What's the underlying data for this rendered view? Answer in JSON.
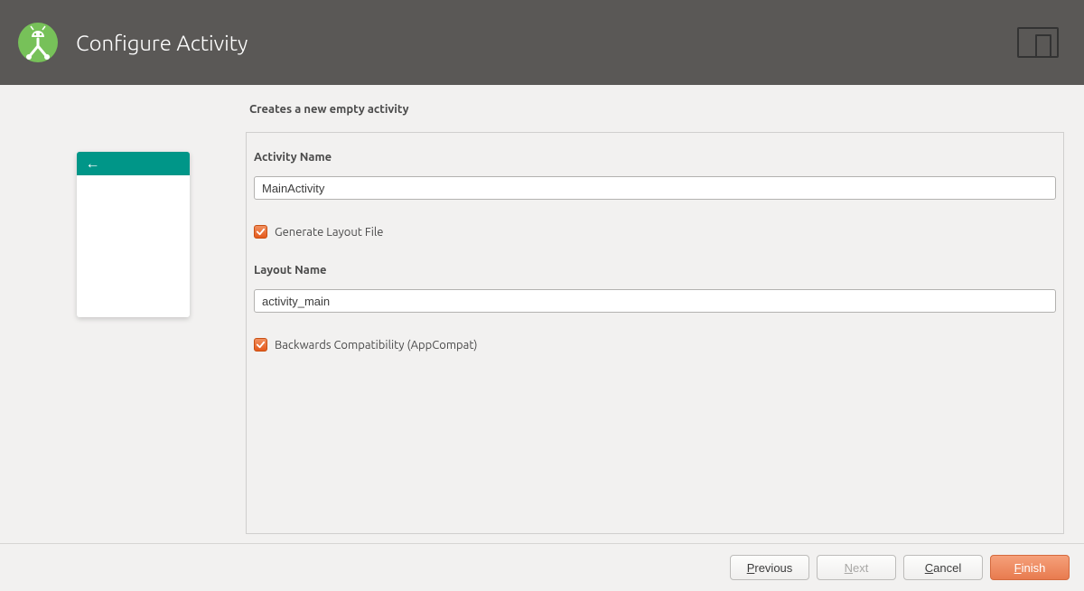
{
  "header": {
    "title": "Configure Activity"
  },
  "main": {
    "description": "Creates a new empty activity",
    "fields": {
      "activity_name_label": "Activity Name",
      "activity_name_value": "MainActivity",
      "generate_layout_label": "Generate Layout File",
      "generate_layout_checked": true,
      "layout_name_label": "Layout Name",
      "layout_name_value": "activity_main",
      "backwards_compat_label": "Backwards Compatibility (AppCompat)",
      "backwards_compat_checked": true
    }
  },
  "footer": {
    "previous": "Previous",
    "next": "Next",
    "cancel": "Cancel",
    "finish": "Finish"
  }
}
